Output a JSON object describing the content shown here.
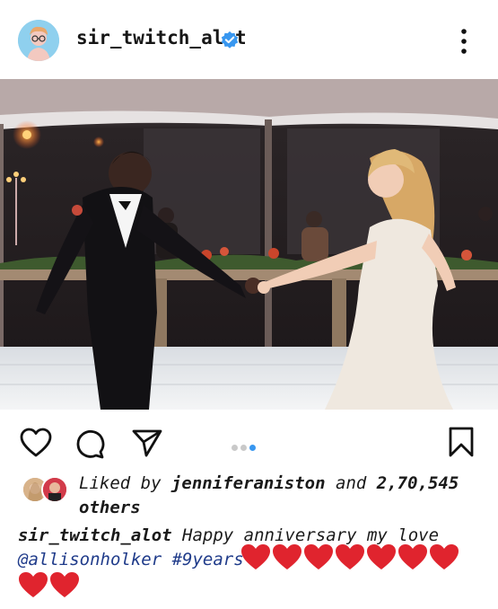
{
  "post": {
    "username": "sir_twitch_alot",
    "verified": true,
    "image_description_icon": "wedding-dance-photo",
    "carousel": {
      "total": 3,
      "active": 3
    },
    "likes": {
      "prefix": "Liked by",
      "liker": "jenniferaniston",
      "connector": "and",
      "count": "2,70,545",
      "suffix": "others"
    },
    "caption": {
      "author": "sir_twitch_alot",
      "text": "Happy anniversary my love",
      "mention": "@allisonholker",
      "hashtag": "#9years",
      "emoji": "red-heart",
      "emoji_count": 9
    }
  },
  "colors": {
    "accent": "#3897f0",
    "heart": "#e0242e",
    "mention": "#1f3b8a"
  }
}
